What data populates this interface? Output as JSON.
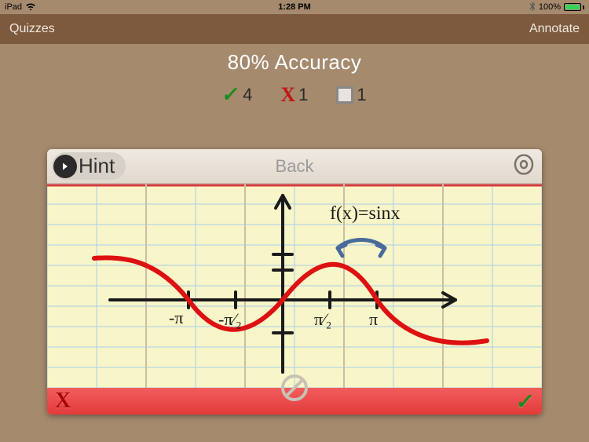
{
  "statusbar": {
    "device": "iPad",
    "time": "1:28 PM",
    "battery_pct": "100%"
  },
  "navbar": {
    "left": "Quizzes",
    "right": "Annotate"
  },
  "accuracy": {
    "title": "80% Accuracy",
    "correct_count": "4",
    "wrong_count": "1",
    "skipped_count": "1"
  },
  "card": {
    "hint_label": "Hint",
    "back_label": "Back"
  },
  "graph": {
    "function_label": "f(x)=sinx",
    "tick_labels": {
      "neg_pi": "-π",
      "neg_pi2": "-π/2",
      "pi2": "π/2",
      "pi": "π"
    }
  },
  "icons": {
    "arrow_right": "arrow-right-icon",
    "target": "target-icon",
    "cancel": "cancel-icon",
    "wifi": "wifi-icon",
    "bluetooth": "bluetooth-icon",
    "battery": "battery-icon",
    "check": "check-icon",
    "x": "x-icon",
    "square": "unanswered-square-icon"
  }
}
